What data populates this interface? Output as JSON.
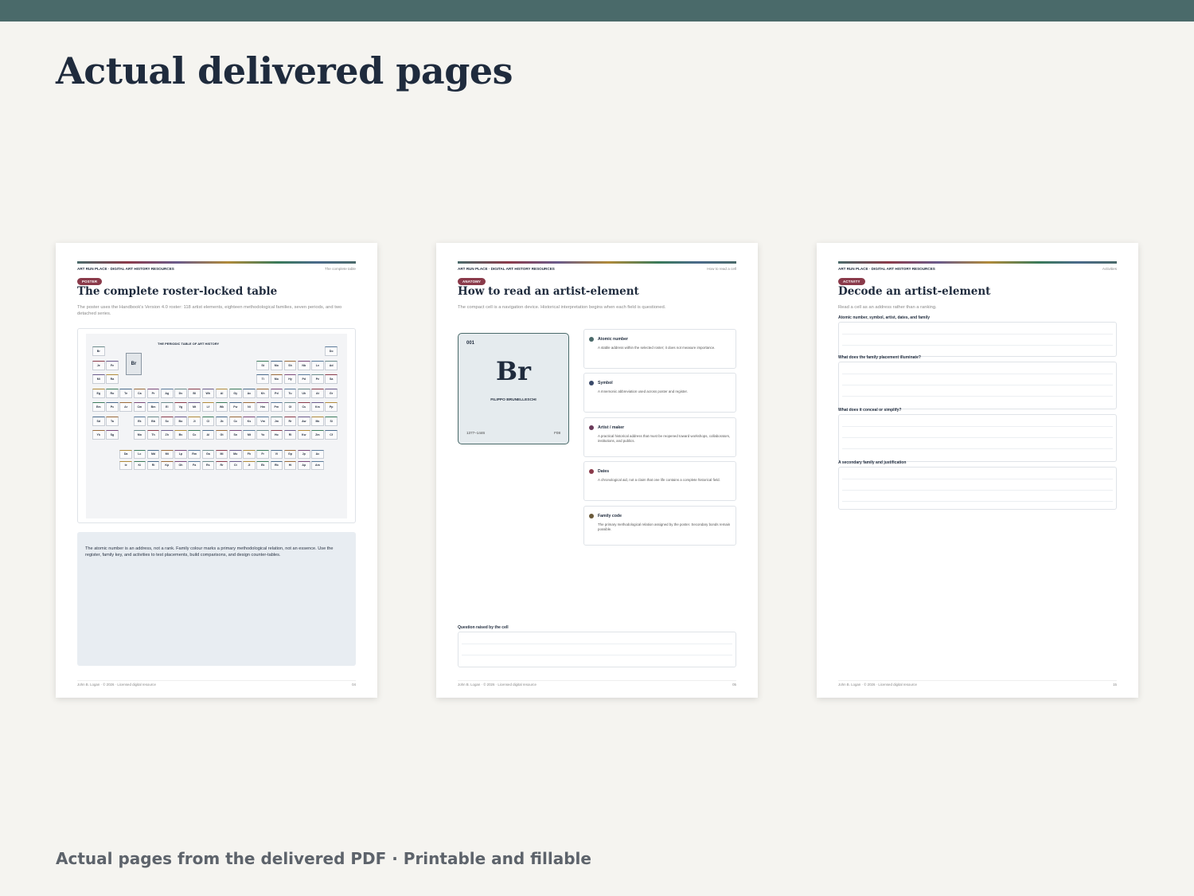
{
  "main_title": "Actual delivered pages",
  "caption": "Actual pages from the delivered PDF · Printable and fillable",
  "colors": {
    "topbar": "#4a6a6a",
    "badge": "#8a3a4a",
    "background": "#f5f4f0"
  },
  "page1": {
    "header_left": "ART RUN PLACE · DIGITAL ART HISTORY RESOURCES",
    "header_right": "The complete table",
    "badge": "POSTER",
    "title": "The complete roster-locked table",
    "lead": "The poster uses the Handbook's Version 4.0 roster: 118 artist elements, eighteen methodological families, seven periods, and two detached series.",
    "poster_title": "THE PERIODIC TABLE OF ART HISTORY",
    "poster_feature": "Br",
    "poster_cells": [
      "Br",
      "Do",
      "Je",
      "Fe",
      "St",
      "Mo",
      "Sh",
      "Nb",
      "Lv",
      "Ad",
      "Mi",
      "Ra",
      "Ti",
      "Mo",
      "Hy",
      "Pd",
      "Pe",
      "Sa",
      "Eg",
      "Ro",
      "Te",
      "Ca",
      "Pr",
      "Ag",
      "Dv",
      "Bl",
      "Wh",
      "Al",
      "Gy",
      "Ac",
      "Kh",
      "Pd",
      "Tu",
      "Uh",
      "At",
      "Gr",
      "Em",
      "Pc",
      "Ar",
      "Cm",
      "Bm",
      "El",
      "Vg",
      "Mt",
      "Lf",
      "Wk",
      "Fw",
      "Ni",
      "Hm",
      "Pm",
      "Ol",
      "Cs",
      "Km",
      "Pp",
      "Sd",
      "Ta",
      "Ek",
      "Bb",
      "Sc",
      "Bo",
      "Ji",
      "Cl",
      "Jb",
      "Cc",
      "Ks",
      "Vm",
      "Jm",
      "Rr",
      "Aw",
      "Mc",
      "Si",
      "Yk",
      "Sg",
      "Mo",
      "Th",
      "Zh",
      "Bv",
      "Cc",
      "Al",
      "Gt",
      "Sn",
      "Mt",
      "Yo",
      "Ho",
      "Rl",
      "Kw",
      "Zm",
      "Cf"
    ],
    "poster_series": [
      "Da",
      "Lc",
      "Md",
      "Mt",
      "Lp",
      "Rm",
      "Ga",
      "Mi",
      "Mo",
      "Fh",
      "Fr",
      "Vi",
      "Gp",
      "Jp",
      "Ac",
      "Ie",
      "Ki",
      "Ri",
      "Kp",
      "Oh",
      "Fa",
      "Rs",
      "Rr",
      "Ct",
      "Jl",
      "Ek",
      "Rb",
      "Hi",
      "Ap",
      "Am"
    ],
    "note": "The atomic number is an address, not a rank. Family colour marks a primary methodological relation, not an essence. Use the register, family key, and activities to test placements, build comparisons, and design counter-tables.",
    "footer_left": "John B. Logan · © 2026 · Licensed digital resource",
    "footer_right": "04"
  },
  "page2": {
    "header_left": "ART RUN PLACE · DIGITAL ART HISTORY RESOURCES",
    "header_right": "How to read a cell",
    "badge": "ANATOMY",
    "title": "How to read an artist-element",
    "lead": "The compact cell is a navigation device. Historical interpretation begins when each field is questioned.",
    "cell": {
      "number": "001",
      "symbol": "Br",
      "name": "FILIPPO BRUNELLESCHI",
      "dates": "1377–1446",
      "family": "F08"
    },
    "fields": [
      {
        "title": "Atomic number",
        "desc": "A stable address within the selected roster; it does not measure importance.",
        "color": "#4a6a6a"
      },
      {
        "title": "Symbol",
        "desc": "A mnemonic abbreviation used across poster and register.",
        "color": "#3a4a6a"
      },
      {
        "title": "Artist / maker",
        "desc": "A practical historical address that must be reopened toward workshops, collaborators, institutions, and publics.",
        "color": "#6a3a5a"
      },
      {
        "title": "Dates",
        "desc": "A chronological aid, not a claim that one life contains a complete historical field.",
        "color": "#8a3a4a"
      },
      {
        "title": "Family code",
        "desc": "The primary methodological relation assigned by the poster. Secondary bonds remain possible.",
        "color": "#6a5a3a"
      }
    ],
    "question_label": "Question raised by the cell",
    "footer_left": "John B. Logan · © 2026 · Licensed digital resource",
    "footer_right": "05"
  },
  "page3": {
    "header_left": "ART RUN PLACE · DIGITAL ART HISTORY RESOURCES",
    "header_right": "Activities",
    "badge": "ACTIVITY",
    "title": "Decode an artist-element",
    "lead": "Read a cell as an address rather than a ranking.",
    "prompts": [
      "Atomic number, symbol, artist, dates, and family",
      "What does the family placement illuminate?",
      "What does it conceal or simplify?",
      "A secondary family and justification"
    ],
    "footer_left": "John B. Logan · © 2026 · Licensed digital resource",
    "footer_right": "15"
  }
}
